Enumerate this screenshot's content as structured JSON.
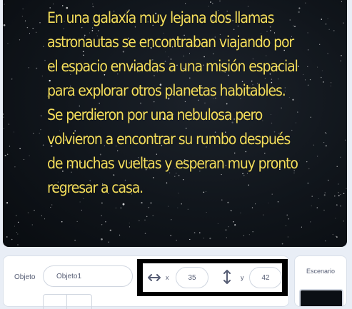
{
  "stage": {
    "story_text": "En una galaxía muy lejana dos llamas astronautas se encontraban viajando por el espacio enviadas a una misión espacial para explorar otros planetas habitables. Se perdieron por una nebulosa pero volvieron a encontrar su rumbo después de muchas vueltas y esperan muy pronto regresar a casa.",
    "text_color": "#f4de5c"
  },
  "sprite_info": {
    "label": "Objeto",
    "name_value": "Objeto1",
    "x_label": "x",
    "x_value": "35",
    "y_label": "y",
    "y_value": "42"
  },
  "stage_panel": {
    "label": "Escenario"
  }
}
